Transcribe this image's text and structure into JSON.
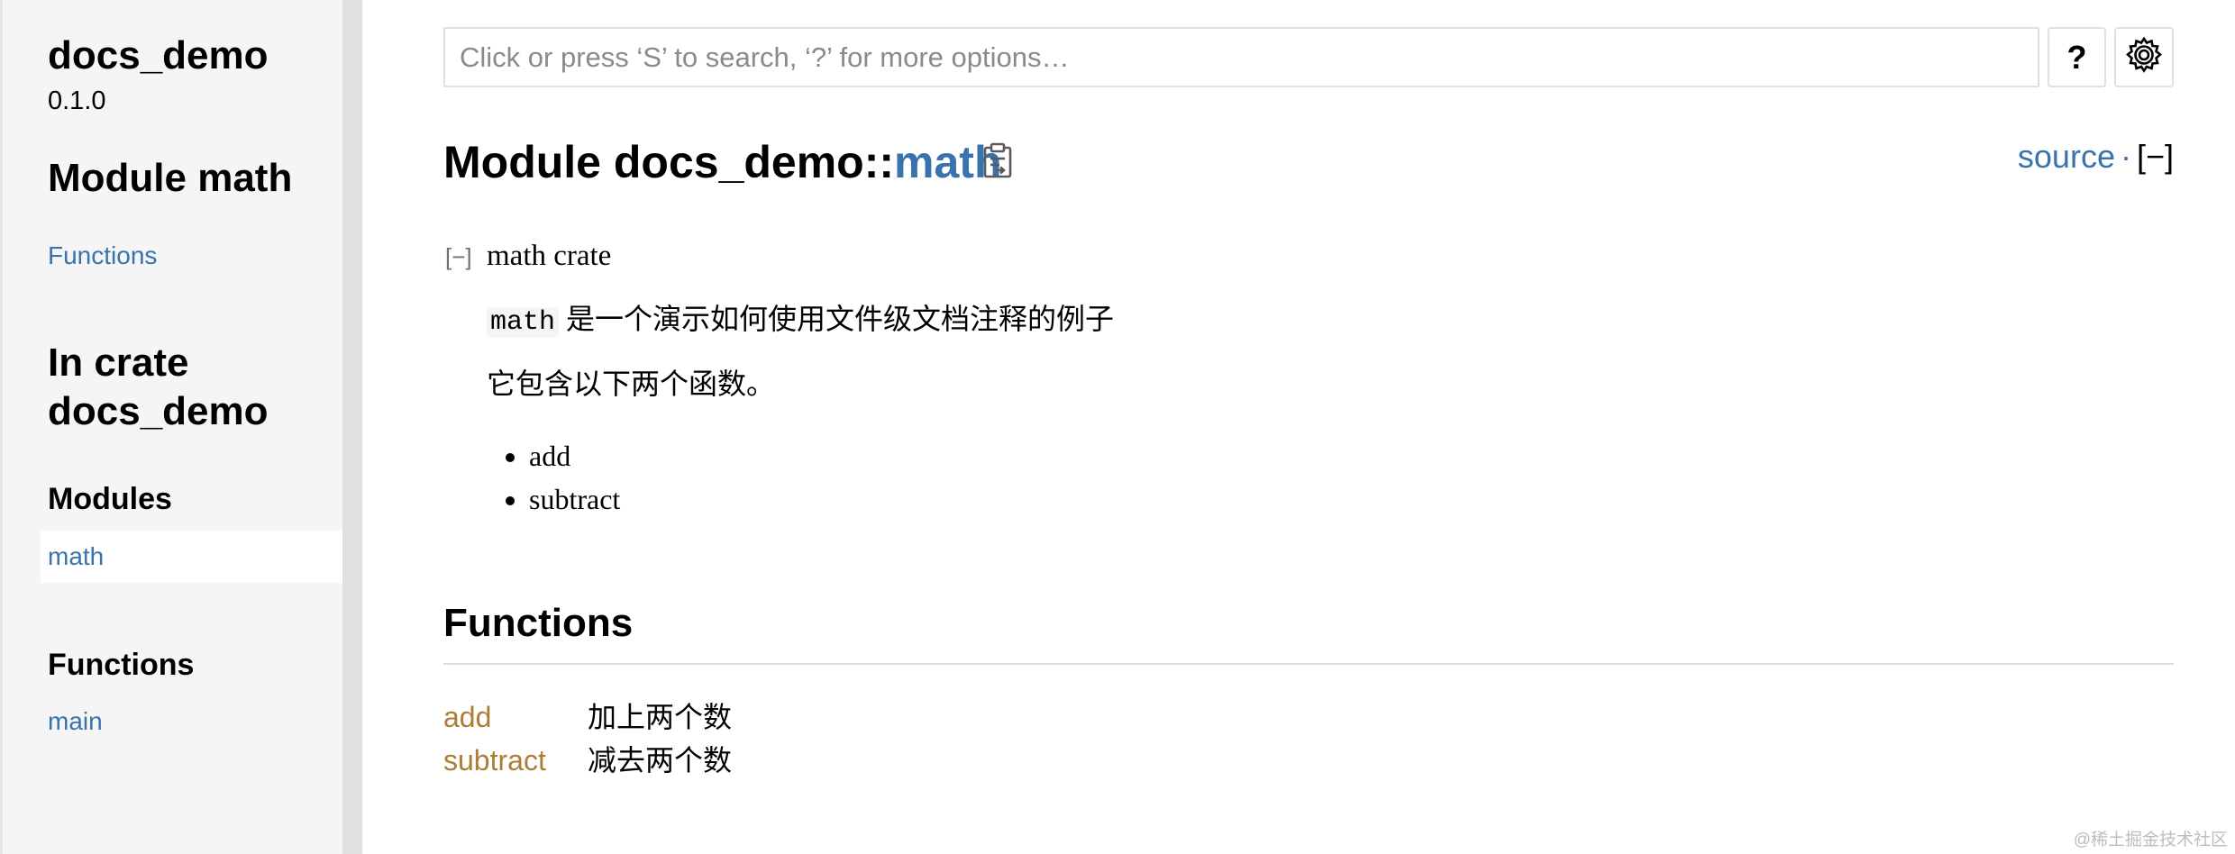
{
  "sidebar": {
    "crate_name": "docs_demo",
    "version": "0.1.0",
    "module_heading": "Module math",
    "module_links": {
      "functions": "Functions"
    },
    "in_crate_heading": "In crate docs_demo",
    "modules_heading": "Modules",
    "modules": [
      "math"
    ],
    "functions_heading": "Functions",
    "functions": [
      "main"
    ]
  },
  "search": {
    "placeholder": "Click or press ‘S’ to search, ‘?’ for more options…",
    "help_label": "?",
    "settings_icon": "gear-icon"
  },
  "header": {
    "title_prefix": "Module docs_demo::",
    "module_name": "math",
    "copy_icon": "clipboard-icon",
    "source_link": "source",
    "separator": "·",
    "collapse_all": "[−]"
  },
  "docs": {
    "toggle": "[−]",
    "summary": "math crate",
    "code_word": "math",
    "line1_rest": " 是一个演示如何使用文件级文档注释的例子",
    "line2": "它包含以下两个函数。",
    "bullets": [
      "add",
      "subtract"
    ]
  },
  "functions_section": {
    "heading": "Functions",
    "items": [
      {
        "name": "add",
        "desc": "加上两个数"
      },
      {
        "name": "subtract",
        "desc": "减去两个数"
      }
    ]
  },
  "colors": {
    "link_blue": "#3873ad",
    "fn_gold": "#ad7c37",
    "sidebar_bg": "#f5f5f5"
  },
  "watermark": "@稀土掘金技术社区"
}
